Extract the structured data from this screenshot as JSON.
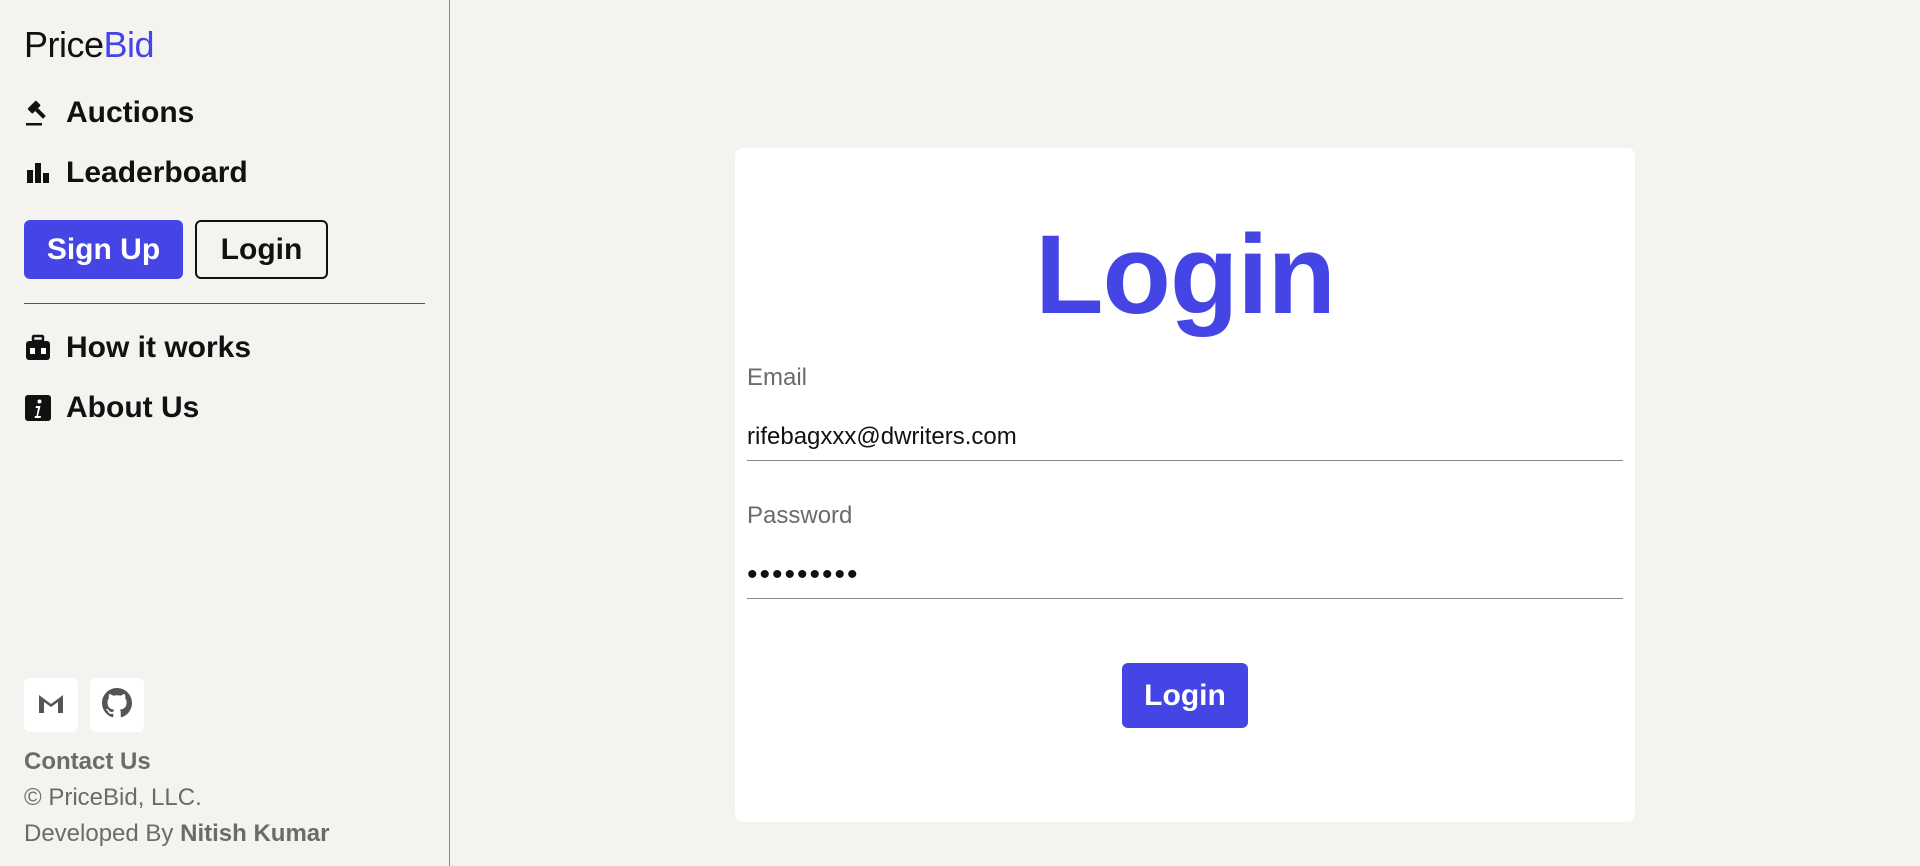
{
  "sidebar": {
    "logo": {
      "part_a": "Price",
      "part_b": "Bid"
    },
    "nav": [
      {
        "label": "Auctions",
        "icon": "gavel-icon"
      },
      {
        "label": "Leaderboard",
        "icon": "bar-chart-icon"
      }
    ],
    "signup_label": "Sign Up",
    "login_label": "Login",
    "secondary_nav": [
      {
        "label": "How it works",
        "icon": "toolbox-icon"
      },
      {
        "label": "About Us",
        "icon": "info-icon"
      }
    ],
    "footer": {
      "social": [
        "gmail-icon",
        "github-icon"
      ],
      "contact_label": "Contact Us",
      "copyright": "© PriceBid, LLC.",
      "developed_by_prefix": "Developed By",
      "developer_name": "Nitish Kumar"
    }
  },
  "login_form": {
    "title": "Login",
    "email_label": "Email",
    "email_value": "rifebagxxx@dwriters.com",
    "password_label": "Password",
    "password_value": "•••••••••",
    "submit_label": "Login"
  },
  "colors": {
    "accent": "#4545e6",
    "background": "#f4f3f0",
    "card": "#ffffff",
    "muted_text": "#6b6b6b"
  }
}
